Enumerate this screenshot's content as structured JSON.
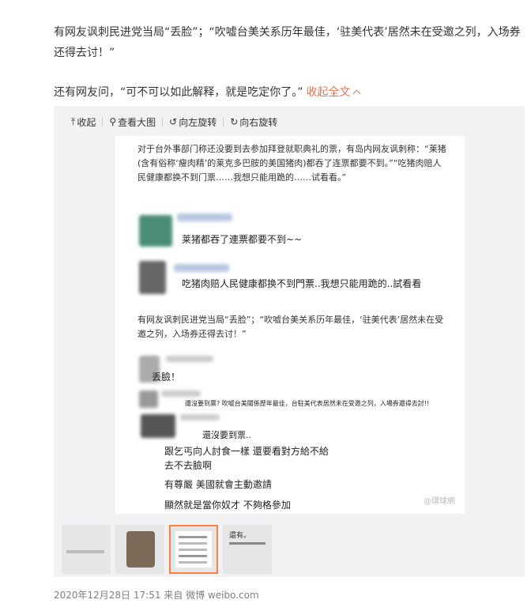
{
  "post": {
    "paragraph1": "有网友讽刺民进党当局“丢脸”；“吹嘘台美关系历年最佳，‘驻美代表’居然未在受邀之列，入场券还得去讨！”",
    "paragraph2": "还有网友问，“可不可以如此解释，就是吃定你了。”",
    "collapse_label": "收起全文"
  },
  "toolbar": {
    "collapse": "收起",
    "view_large": "查看大图",
    "rotate_left": "向左旋转",
    "rotate_right": "向右旋转"
  },
  "photo": {
    "intro": "对于台外事部门称还没要到去参加拜登就职典礼的票，有岛内网友讽刺称：“莱猪(含有俗称‘瘦肉精’的莱克多巴胺的美国猪肉)都吞了连票都要不到。”“吃猪肉赔人民健康都换不到门票……我想只能用跪的……试看看。”",
    "comment1": "莱猪都吞了連票都要不到~~",
    "comment2": "吃猪肉赔人民健康都换不到門票..我想只能用跪的..試看看",
    "middle": "有网友讽刺民进党当局“丢脸”；“吹嘘台美关系历年最佳，‘驻美代表’居然未在受邀之列，入场券还得去讨！”",
    "comment3": "丢臉！",
    "comment4": "還沒要到票? 吹嘘台美關係歷年最佳，台駐美代表居然未在受邀之列，入場券還得去討!!",
    "comment5": "還沒要到票..",
    "line6": "跟乞丐向人討食一樣 還要看對方給不給",
    "line7": "去不去臉啊",
    "line8": "有尊嚴 美國就會主動邀請",
    "line9": "顯然就是當你奴才 不夠格參加",
    "watermark": "@環球網"
  },
  "thumbs": {
    "t4_text": "還有。"
  },
  "footer": {
    "date": "2020年12月28日 17:51",
    "from": "来自 微博 weibo.com"
  }
}
